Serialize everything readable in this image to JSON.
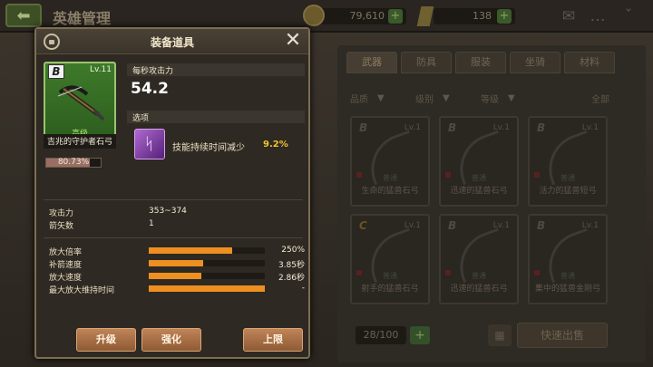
{
  "header": {
    "title": "英雄管理",
    "gold": "79,610",
    "gems": "138"
  },
  "inventory": {
    "tabs": [
      "武器",
      "防具",
      "服装",
      "坐骑",
      "材料"
    ],
    "active_tab": 0,
    "filters": [
      "品质",
      "级别",
      "等级",
      "全部"
    ],
    "items": [
      {
        "level": "Lv.1",
        "grade": "普通",
        "name": "生命的猛兽石弓",
        "badge": "B"
      },
      {
        "level": "Lv.1",
        "grade": "普通",
        "name": "迅速的猛兽石弓",
        "badge": "B"
      },
      {
        "level": "Lv.1",
        "grade": "普通",
        "name": "活力的猛兽短弓",
        "badge": "B"
      },
      {
        "level": "Lv.1",
        "grade": "普通",
        "name": "射手的猛兽石弓",
        "badge": "C"
      },
      {
        "level": "Lv.1",
        "grade": "普通",
        "name": "迅速的猛兽石弓",
        "badge": "B"
      },
      {
        "level": "Lv.1",
        "grade": "普通",
        "name": "集中的猛兽金刚弓",
        "badge": "B"
      }
    ],
    "count": "28/100",
    "sell_label": "快速出售"
  },
  "modal": {
    "title": "装备道具",
    "item": {
      "badge": "B",
      "level": "Lv.11",
      "grade": "高级",
      "name": "吉兆的守护者石弓",
      "progress_text": "80.73%",
      "progress": 0.8073
    },
    "dps_label": "每秒攻击力",
    "dps_value": "54.2",
    "option_label": "选项",
    "option": {
      "name": "技能持续时间减少",
      "value": "9.2%"
    },
    "stats": [
      {
        "name": "攻击力",
        "value": "353~374"
      },
      {
        "name": "箭矢数",
        "value": "1"
      }
    ],
    "bar_stats": [
      {
        "name": "放大倍率",
        "value": "250%",
        "fill": 0.72
      },
      {
        "name": "补箭速度",
        "value": "3.85秒",
        "fill": 0.47
      },
      {
        "name": "放大速度",
        "value": "2.86秒",
        "fill": 0.45
      },
      {
        "name": "最大放大维持时间",
        "value": "-",
        "fill": 1.0
      }
    ],
    "buttons": {
      "upgrade": "升级",
      "enhance": "强化",
      "limit": "上限"
    }
  },
  "colors": {
    "accent": "#ee8f22",
    "option_value": "#f1c232",
    "card_green": "#3e7a2a",
    "button": "#c08458"
  }
}
